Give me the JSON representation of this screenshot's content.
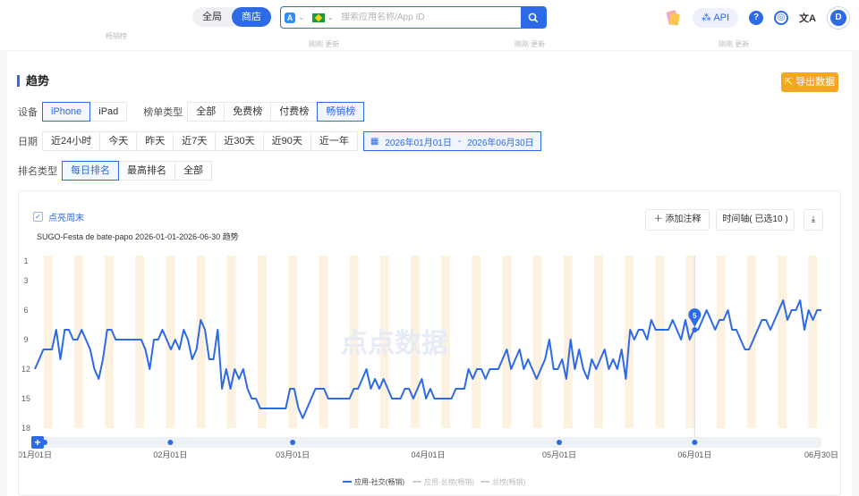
{
  "topbar": {
    "scope": [
      "全局",
      "商店"
    ],
    "scope_active": 1,
    "search_placeholder": "搜索应用名称/App ID",
    "api_label": "API",
    "help_icon_text": "?",
    "translate_icon_text": "文A",
    "avatar_text": "D"
  },
  "remnants": {
    "rank_label": "畅销榜",
    "update_label": "刚刚 更新"
  },
  "trend": {
    "title": "趋势",
    "export_label": "导出数据",
    "device": {
      "label": "设备",
      "options": [
        "iPhone",
        "iPad"
      ],
      "active": 0
    },
    "list_type": {
      "label": "榜单类型",
      "options": [
        "全部",
        "免费榜",
        "付费榜",
        "畅销榜"
      ],
      "active": 3
    },
    "date": {
      "label": "日期",
      "options": [
        "近24小时",
        "今天",
        "昨天",
        "近7天",
        "近30天",
        "近90天",
        "近一年"
      ],
      "start": "2026年01月01日",
      "sep": "-",
      "end": "2026年06月30日"
    },
    "rank_type": {
      "label": "排名类型",
      "options": [
        "每日排名",
        "最高排名",
        "全部"
      ],
      "active": 0
    }
  },
  "chart_controls": {
    "weekend_label": "点亮周末",
    "add_note_label": "添加注释",
    "timeline_label": "时间轴( 已选10 )",
    "watermark_text": "点点数据"
  },
  "colors": {
    "accent": "#2d6ae6",
    "export": "#f5a623",
    "weekend": "#fdf1df"
  },
  "chart_data": {
    "type": "line",
    "title": "SUGO-Festa de bate-papo 2026-01-01-2026-06-30 趋势",
    "y_reversed": true,
    "ylim": [
      1,
      18
    ],
    "y_ticks": [
      1,
      3,
      6,
      9,
      12,
      15,
      18
    ],
    "x_tick_labels": [
      "01月01日",
      "02月01日",
      "03月01日",
      "04月01日",
      "05月01日",
      "06月01日",
      "06月30日"
    ],
    "x_tick_days": [
      0,
      31,
      59,
      90,
      120,
      151,
      180
    ],
    "legend_position": "bottom",
    "series": [
      {
        "name": "应用-社交(畅销)",
        "color": "#2d6ae6",
        "values": [
          12,
          11,
          10,
          10,
          10,
          8,
          11,
          8,
          8,
          9,
          9,
          8,
          9,
          10,
          12,
          13,
          11,
          8,
          8,
          9,
          9,
          9,
          9,
          9,
          9,
          9,
          10,
          12,
          9,
          9,
          8,
          9,
          10,
          9,
          10,
          8,
          9,
          11,
          10,
          7,
          8,
          11,
          11,
          8,
          14,
          12,
          14,
          12,
          13,
          12,
          14,
          15,
          15,
          16,
          16,
          16,
          16,
          16,
          16,
          16,
          14,
          14,
          16,
          17,
          16,
          15,
          14,
          14,
          14,
          15,
          15,
          15,
          15,
          15,
          15,
          14,
          14,
          13,
          12,
          14,
          13,
          14,
          13,
          14,
          15,
          15,
          15,
          14,
          14,
          15,
          14,
          13,
          15,
          14,
          15,
          15,
          15,
          15,
          15,
          14,
          14,
          14,
          12,
          13,
          12,
          12,
          13,
          12,
          12,
          12,
          11,
          10,
          12,
          11,
          10,
          12,
          11,
          12,
          13,
          12,
          11,
          9,
          12,
          12,
          11,
          13,
          9,
          12,
          10,
          12,
          13,
          11,
          12,
          11,
          10,
          12,
          11,
          12,
          10,
          13,
          8,
          9,
          8,
          8,
          9,
          7,
          8,
          8,
          8,
          8,
          7,
          8,
          9,
          7,
          9,
          8,
          8,
          7,
          6,
          7,
          8,
          7,
          7,
          6,
          8,
          8,
          9,
          10,
          10,
          9,
          8,
          7,
          7,
          8,
          7,
          6,
          5,
          7,
          6,
          6,
          5,
          8,
          6,
          7,
          6,
          6
        ],
        "marker": {
          "day": 151,
          "label": "5"
        }
      },
      {
        "name": "应用-总榜(畅销)",
        "color": "#cccccc",
        "inactive": true
      },
      {
        "name": "总榜(畅销)",
        "color": "#cccccc",
        "inactive": true
      }
    ],
    "timeline_event_days": [
      0,
      31,
      59,
      120,
      151
    ]
  }
}
